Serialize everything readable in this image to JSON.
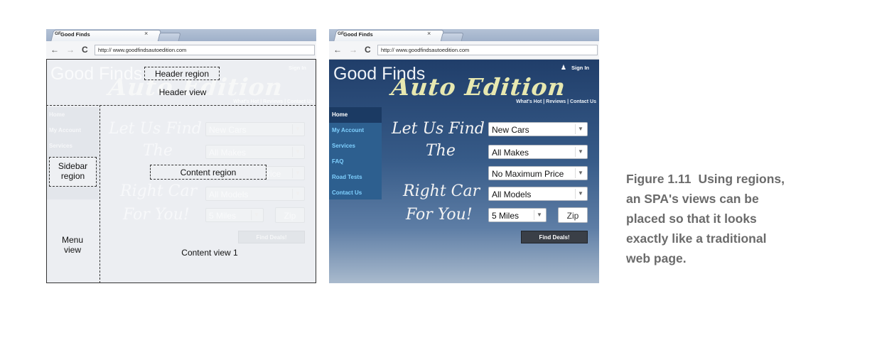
{
  "browser": {
    "tab_title": "Good Finds",
    "favicon_text": "GF",
    "tab_close": "×",
    "url": "http:// www.goodfindsautoedition.com",
    "back_glyph": "←",
    "forward_glyph": "→",
    "reload_glyph": "C"
  },
  "site": {
    "logo_good": "Good Finds",
    "logo_auto": "Auto Edition",
    "sign_in": "Sign In",
    "header_links": "What's Hot | Reviews | Contact Us",
    "menu": [
      "Home",
      "My Account",
      "Services",
      "FAQ",
      "Road Tests",
      "Contact Us"
    ],
    "tagline": [
      "Let Us Find",
      "The",
      "Right Car",
      "For You!"
    ],
    "selects": [
      "New Cars",
      "All Makes",
      "No Maximum Price",
      "All Models"
    ],
    "distance": "5 Miles",
    "zip_placeholder": "Zip",
    "find_button": "Find Deals!"
  },
  "annotations": {
    "header_region": "Header region",
    "header_view": "Header view",
    "sidebar_region": "Sidebar region",
    "content_region": "Content region",
    "menu_view": "Menu view",
    "content_view": "Content view 1"
  },
  "caption": {
    "figure": "Figure 1.11",
    "text": "Using regions, an SPA's views can be placed so that it looks exactly like a traditional web page."
  },
  "colors": {
    "site_header": "#203e6a",
    "menu_active": "#1b3a63",
    "menu_link": "#7fd0ff",
    "logo_auto": "#e7e8b0",
    "caption": "#6b6b6b"
  },
  "icons": [
    "back-arrow-icon",
    "forward-arrow-icon",
    "reload-icon",
    "user-icon",
    "dropdown-arrow-icon"
  ]
}
